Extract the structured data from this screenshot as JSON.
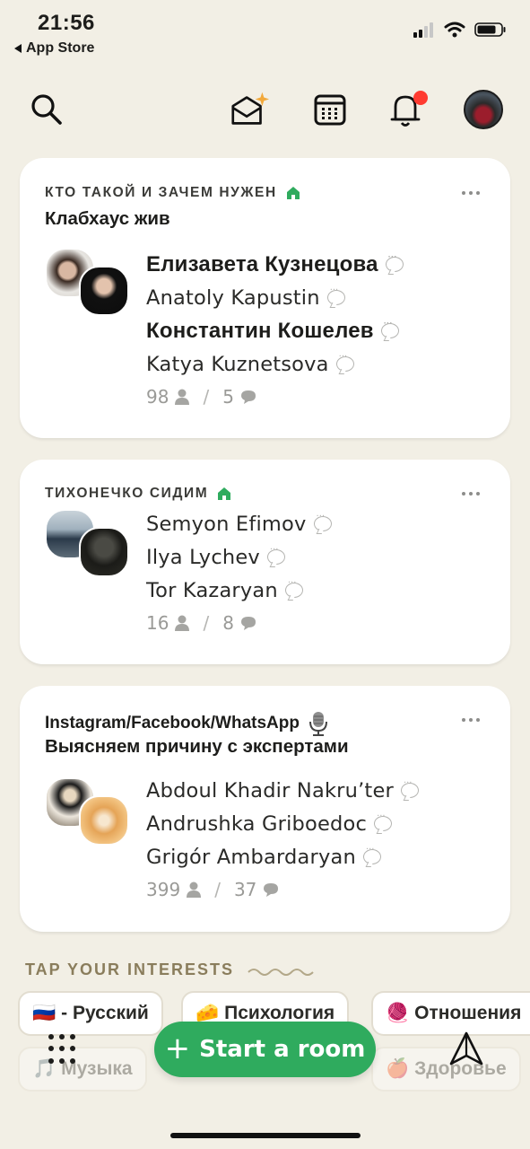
{
  "status": {
    "time": "21:56",
    "back_label": "App Store"
  },
  "icons": {
    "search": "search-icon",
    "invites": "envelope-sparkle-icon",
    "calendar": "calendar-icon",
    "notifications": "bell-icon",
    "profile": "avatar",
    "more": "more-dots-icon",
    "house": "house-icon",
    "mic": "microphone-icon",
    "grid": "grid-dots-icon",
    "send": "paper-plane-icon"
  },
  "colors": {
    "accent": "#2fab5e",
    "notification_dot": "#ff3b30",
    "background": "#f2efe5"
  },
  "rooms": [
    {
      "club": "КТО ТАКОЙ И ЗАЧЕМ НУЖЕН",
      "title": "Клабхаус жив",
      "speakers": [
        "Елизавета Кузнецова",
        "Anatoly Kapustin",
        "Константин Кошелев",
        "Katya Kuznetsova"
      ],
      "listeners": "98",
      "speaker_count": "5"
    },
    {
      "club": "ТИХОНЕЧКО СИДИМ",
      "title": "",
      "speakers": [
        "Semyon Efimov",
        "Ilya Lychev",
        "Tor Kazaryan"
      ],
      "listeners": "16",
      "speaker_count": "8"
    },
    {
      "club": "Instagram/Facebook/WhatsApp",
      "title": "Выясняем причину с экспертами",
      "speakers": [
        "Abdoul Khadir Nakru’ter",
        "Andrushka Griboedoc",
        "Grigór Ambardaryan"
      ],
      "listeners": "399",
      "speaker_count": "37"
    }
  ],
  "interests": {
    "header": "TAP YOUR INTERESTS",
    "chips": [
      {
        "emoji": "🇷🇺",
        "label": "- Русский"
      },
      {
        "emoji": "🧀",
        "label": "Психология"
      },
      {
        "emoji": "🧶",
        "label": "Отношения"
      },
      {
        "emoji": "🎵",
        "label": "Музыка"
      },
      {
        "emoji": "🍎",
        "label": "Здоровье"
      }
    ]
  },
  "bottom": {
    "start_room": "Start a room"
  }
}
